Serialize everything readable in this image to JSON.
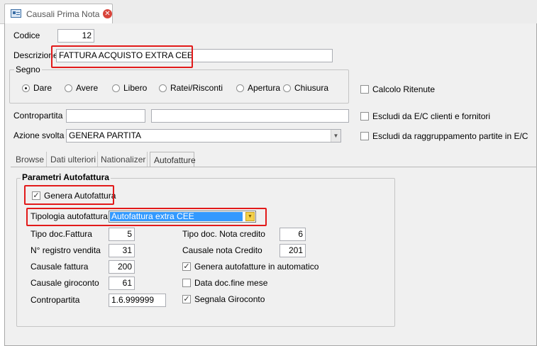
{
  "window": {
    "tab_title": "Causali Prima Nota",
    "tab_icon": "form-icon",
    "close_icon": "close-icon"
  },
  "form": {
    "codice_label": "Codice",
    "codice_value": "12",
    "descrizione_label": "Descrizione",
    "descrizione_value": "FATTURA ACQUISTO EXTRA CEE",
    "segno": {
      "title": "Segno",
      "options": [
        "Dare",
        "Avere",
        "Libero",
        "Ratei/Risconti",
        "Apertura",
        "Chiusura"
      ],
      "selected": "Dare"
    },
    "calcolo_ritenute": "Calcolo Ritenute",
    "contropartita_label": "Contropartita",
    "contropartita_value": "",
    "contropartita_desc": "",
    "escludi_ec": "Escludi da E/C clienti e fornitori",
    "azione_label": "Azione svolta",
    "azione_value": "GENERA PARTITA",
    "escludi_raggruppamento": "Escludi da raggruppamento partite in E/C"
  },
  "tabs": [
    "Browse",
    "Dati ulteriori",
    "Nationalizer",
    "Autofatture"
  ],
  "active_tab": "Autofatture",
  "autofattura": {
    "title": "Parametri Autofattura",
    "genera": {
      "label": "Genera Autofattura",
      "checked": true
    },
    "tipologia_label": "Tipologia autofattura",
    "tipologia_value": "Autofattura extra CEE",
    "tipo_doc_fattura_label": "Tipo doc.Fattura",
    "tipo_doc_fattura_value": "5",
    "registro_label": "N° registro vendita",
    "registro_value": "31",
    "causale_fattura_label": "Causale fattura",
    "causale_fattura_value": "200",
    "causale_giroconto_label": "Causale giroconto",
    "causale_giroconto_value": "61",
    "contropartita_label": "Contropartita",
    "contropartita_value": "1.6.999999",
    "tipo_doc_nota_label": "Tipo doc. Nota credito",
    "tipo_doc_nota_value": "6",
    "causale_nota_label": "Causale nota Credito",
    "causale_nota_value": "201",
    "genera_auto": {
      "label": "Genera autofatture in automatico",
      "checked": true
    },
    "data_fine_mese": {
      "label": "Data doc.fine mese",
      "checked": false
    },
    "segnala_giroconto": {
      "label": "Segnala Giroconto",
      "checked": true
    }
  },
  "colors": {
    "highlight_red": "#e21a1a",
    "selection_blue": "#3399ff",
    "panel": "#f0f0f0"
  }
}
